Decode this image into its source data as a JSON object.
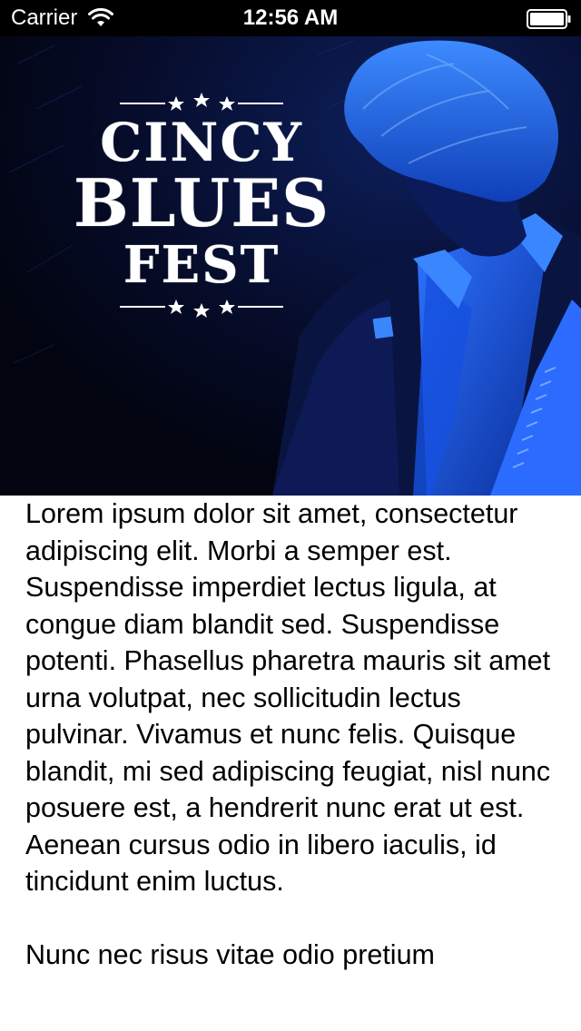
{
  "status_bar": {
    "carrier": "Carrier",
    "time": "12:56 AM",
    "wifi_icon": "wifi-icon",
    "battery_icon": "battery-icon"
  },
  "hero": {
    "logo": {
      "line1": "CINCY",
      "line2": "BLUES",
      "line3": "FEST"
    },
    "colors": {
      "background": "#04081c",
      "accent_blue": "#1a5cff"
    }
  },
  "article": {
    "paragraphs": [
      "Lorem ipsum dolor sit amet, consectetur adipiscing elit. Morbi a semper est. Suspendisse imperdiet lectus ligula, at congue diam blandit sed. Suspendisse potenti. Phasellus pharetra mauris sit amet urna volutpat, nec sollicitudin lectus pulvinar. Vivamus et nunc felis. Quisque blandit, mi sed adipiscing feugiat, nisl nunc posuere est, a hendrerit nunc erat ut est. Aenean cursus odio in libero iaculis, id tincidunt enim luctus.",
      "Nunc nec risus vitae odio pretium"
    ]
  }
}
